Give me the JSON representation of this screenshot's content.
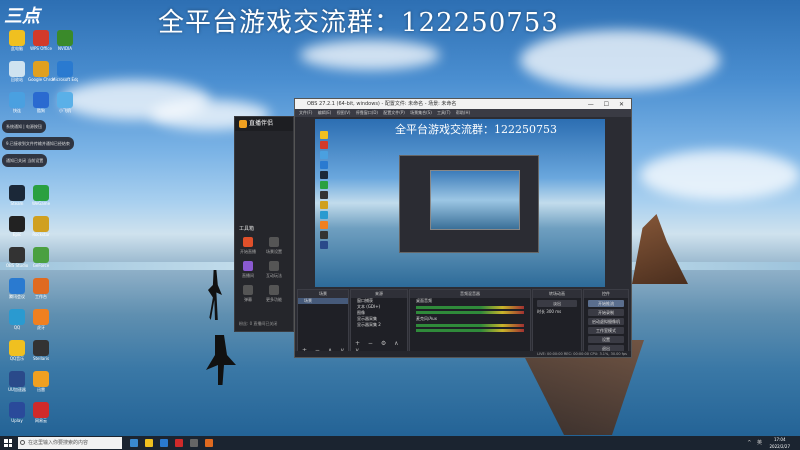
{
  "banner": {
    "text": "全平台游戏交流群：122250753"
  },
  "logo": {
    "text": "三点"
  },
  "desktop_icons": [
    {
      "label": "此电脑",
      "color": "#f0c020"
    },
    {
      "label": "WPS Office",
      "color": "#d23a2a"
    },
    {
      "label": "NVIDIA",
      "color": "#3a8a2a"
    },
    {
      "label": "回收站",
      "color": "#cfe3f0"
    },
    {
      "label": "Google Chrome",
      "color": "#e0a020"
    },
    {
      "label": "Microsoft Edge",
      "color": "#2a7ad0"
    },
    {
      "label": "快连",
      "color": "#4aa0e0"
    },
    {
      "label": "酷狗",
      "color": "#2a6ad0"
    },
    {
      "label": "小飞机",
      "color": "#5ab0e8"
    },
    {
      "label": "Steam",
      "color": "#1b2838"
    },
    {
      "label": "WeGame",
      "color": "#2aa040"
    },
    {
      "label": "Epic",
      "color": "#222"
    },
    {
      "label": "Rockstar",
      "color": "#d0a020"
    },
    {
      "label": "OBS Studio",
      "color": "#333"
    },
    {
      "label": "GeForce",
      "color": "#4aa040"
    },
    {
      "label": "腾讯会议",
      "color": "#2a7ad0"
    },
    {
      "label": "工作台",
      "color": "#e06a20"
    },
    {
      "label": "QQ",
      "color": "#2a9ad0"
    },
    {
      "label": "虎牙",
      "color": "#f08020"
    },
    {
      "label": "QQ音乐",
      "color": "#f0c020"
    },
    {
      "label": "Stellaris",
      "color": "#333"
    },
    {
      "label": "UU加速器",
      "color": "#2a4a8a"
    },
    {
      "label": "迅雷",
      "color": "#f0a020"
    },
    {
      "label": "Uplay",
      "color": "#2a4a9a"
    },
    {
      "label": "网易云",
      "color": "#d02a2a"
    }
  ],
  "toasts": [
    "系统通知 | 电源按钮",
    "9.已接收到文件传输并通知已经结束",
    "通知已关闭 当前设置"
  ],
  "sidepanel": {
    "title": "直播伴侣",
    "section": "工具箱",
    "items": [
      "开始直播",
      "场景设置",
      "直播间",
      "互动玩法",
      "弹幕",
      "更多功能"
    ],
    "hint": "粉丝: 0 直播间已关闭"
  },
  "obs": {
    "title": "OBS 27.2.1 (64-bit, windows) - 配置文件: 未命名 - 场景: 未命名",
    "menu": [
      "文件(F)",
      "编辑(E)",
      "视图(V)",
      "停靠窗口(D)",
      "配置文件(P)",
      "场景集合(S)",
      "工具(T)",
      "帮助(H)"
    ],
    "preview_banner": "全平台游戏交流群：122250753",
    "docks": {
      "scenes": {
        "title": "场景",
        "items": [
          "场景"
        ]
      },
      "sources": {
        "title": "来源",
        "items": [
          "窗口捕获",
          "文本 (GDI+)",
          "图像",
          "显示器采集",
          "显示器采集 2"
        ]
      },
      "mixer": {
        "title": "音频混音器",
        "items": [
          "桌面音频",
          "麦克风/Aux"
        ]
      },
      "transitions": {
        "title": "转场动画",
        "type": "淡出",
        "duration_label": "时长",
        "duration": "300 ms"
      },
      "controls": {
        "title": "控件",
        "buttons": [
          "开始推流",
          "开始录制",
          "启动虚拟摄像机",
          "工作室模式",
          "设置",
          "退出"
        ]
      }
    },
    "status": "LIVE: 00:00:00  REC: 00:00:00  CPU: 3.1%, 30.00 fps"
  },
  "taskbar": {
    "search_placeholder": "在这里输入你要搜索的内容",
    "apps": [
      "#3a8ad0",
      "#f0c020",
      "#2a7ad0",
      "#d02a2a",
      "#666",
      "#e06a20"
    ],
    "tray": "^ 英 ",
    "time": "17:04",
    "date": "2022/2/27"
  }
}
